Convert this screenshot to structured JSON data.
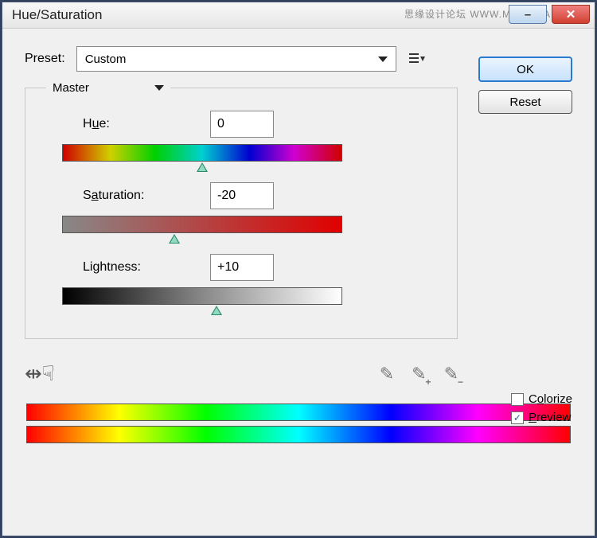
{
  "window": {
    "title": "Hue/Saturation"
  },
  "preset": {
    "label": "Preset:",
    "value": "Custom"
  },
  "channel": {
    "value": "Master"
  },
  "sliders": {
    "hue": {
      "label_pre": "H",
      "label_u": "u",
      "label_post": "e:",
      "value": "0",
      "pos_pct": 50
    },
    "saturation": {
      "label_pre": "S",
      "label_u": "a",
      "label_post": "turation:",
      "value": "-20",
      "pos_pct": 40
    },
    "lightness": {
      "label_pre": "Lightness:",
      "label_u": "",
      "label_post": "",
      "value": "+10",
      "pos_pct": 55
    }
  },
  "buttons": {
    "ok": "OK",
    "reset": "Reset"
  },
  "checks": {
    "colorize": {
      "label_pre": "C",
      "label_u": "o",
      "label_post": "lorize",
      "checked": false
    },
    "preview": {
      "label_pre": "",
      "label_u": "P",
      "label_post": "review",
      "checked": true
    }
  },
  "watermark": "思缘设计论坛  WWW.MISSYUAN.COM"
}
